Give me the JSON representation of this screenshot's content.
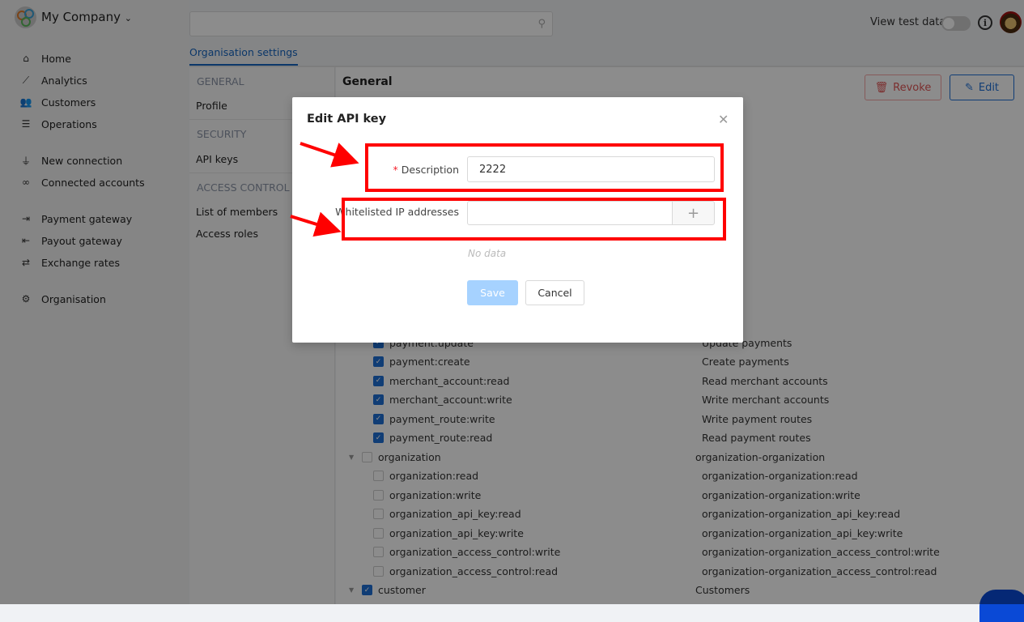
{
  "header": {
    "company": "My Company",
    "search_placeholder": "",
    "view_test_label": "View test data:",
    "view_test_on": false
  },
  "sidebar": {
    "items": [
      {
        "label": "Home",
        "icon": "home-icon",
        "glyph": "⌂"
      },
      {
        "label": "Analytics",
        "icon": "chart-icon",
        "glyph": "⟋"
      },
      {
        "label": "Customers",
        "icon": "users-icon",
        "glyph": "👥"
      },
      {
        "label": "Operations",
        "icon": "list-icon",
        "glyph": "☰"
      },
      {
        "label": "New connection",
        "icon": "plug-icon",
        "glyph": "⏚"
      },
      {
        "label": "Connected accounts",
        "icon": "link-icon",
        "glyph": "∞"
      },
      {
        "label": "Payment gateway",
        "icon": "sign-in-icon",
        "glyph": "⇥"
      },
      {
        "label": "Payout gateway",
        "icon": "sign-out-icon",
        "glyph": "⇤"
      },
      {
        "label": "Exchange rates",
        "icon": "exchange-icon",
        "glyph": "⇄"
      },
      {
        "label": "Organisation",
        "icon": "gear-icon",
        "glyph": "⚙"
      }
    ]
  },
  "tabs": {
    "active": "Organisation settings"
  },
  "settings_menu": {
    "general": "GENERAL",
    "profile": "Profile",
    "security": "SECURITY",
    "api_keys": "API keys",
    "access_control": "ACCESS CONTROL",
    "members": "List of members",
    "roles": "Access roles"
  },
  "content": {
    "title": "General",
    "revoke": "Revoke",
    "edit": "Edit"
  },
  "permissions": [
    {
      "name": "payment:update",
      "desc": "Update payments",
      "checked": true,
      "group": false
    },
    {
      "name": "payment:create",
      "desc": "Create payments",
      "checked": true,
      "group": false
    },
    {
      "name": "merchant_account:read",
      "desc": "Read merchant accounts",
      "checked": true,
      "group": false
    },
    {
      "name": "merchant_account:write",
      "desc": "Write merchant accounts",
      "checked": true,
      "group": false
    },
    {
      "name": "payment_route:write",
      "desc": "Write payment routes",
      "checked": true,
      "group": false
    },
    {
      "name": "payment_route:read",
      "desc": "Read payment routes",
      "checked": true,
      "group": false
    },
    {
      "name": "organization",
      "desc": "organization-organization",
      "checked": false,
      "group": true
    },
    {
      "name": "organization:read",
      "desc": "organization-organization:read",
      "checked": false,
      "group": false
    },
    {
      "name": "organization:write",
      "desc": "organization-organization:write",
      "checked": false,
      "group": false
    },
    {
      "name": "organization_api_key:read",
      "desc": "organization-organization_api_key:read",
      "checked": false,
      "group": false
    },
    {
      "name": "organization_api_key:write",
      "desc": "organization-organization_api_key:write",
      "checked": false,
      "group": false
    },
    {
      "name": "organization_access_control:write",
      "desc": "organization-organization_access_control:write",
      "checked": false,
      "group": false
    },
    {
      "name": "organization_access_control:read",
      "desc": "organization-organization_access_control:read",
      "checked": false,
      "group": false
    },
    {
      "name": "customer",
      "desc": "Customers",
      "checked": true,
      "group": true
    }
  ],
  "modal": {
    "title": "Edit API key",
    "description_label": "Description",
    "description_value": "2222",
    "ip_label": "Whitelisted IP addresses",
    "ip_value": "",
    "empty": "No data",
    "save": "Save",
    "cancel": "Cancel"
  },
  "annotation_color": "#ff0000"
}
